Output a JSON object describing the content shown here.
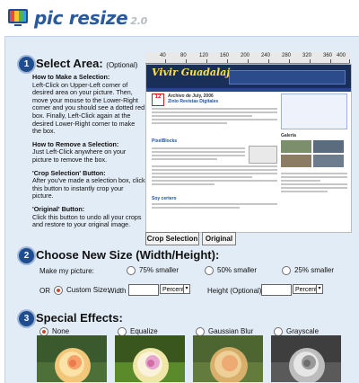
{
  "app": {
    "name": "pic resize",
    "version": "2.0"
  },
  "step1": {
    "number": "1",
    "title": "Select Area:",
    "title_note": "(Optional)",
    "instructions": {
      "selection_heading": "How to Make a Selection:",
      "selection_text": "Left-Click on Upper-Left corner of desired area on your picture. Then, move your mouse to the Lower-Right corner and you should see a dotted red box. Finally, Left-Click again at the desired Lower-Right corner to make the box.",
      "remove_heading": "How to Remove a Selection:",
      "remove_text": "Just Left-Click anywhere on your picture to remove the box.",
      "crop_heading": "'Crop Selection' Button:",
      "crop_text": "After you've made a selection box, click this button to instantly crop your picture.",
      "original_heading": "'Original' Button:",
      "original_text": "Click this button to undo all your crops and restore to your original image."
    },
    "ruler_ticks": [
      "40",
      "80",
      "120",
      "160",
      "200",
      "240",
      "280",
      "320",
      "360",
      "400"
    ],
    "crop_button": "Crop Selection",
    "original_button": "Original"
  },
  "preview": {
    "site_logo": "Vivir Guadalajara",
    "post1_date": "Archivo de July, 2006",
    "post1_title": "Zinio Revistas Digitales",
    "post2_title": "PixelBlocks",
    "post3_title": "Soy certero",
    "side_title": "Galería"
  },
  "step2": {
    "number": "2",
    "title": "Choose New Size (Width/Height):",
    "make_picture_label": "Make my picture:",
    "options": [
      "75% smaller",
      "50% smaller",
      "25% smaller"
    ],
    "or_label": "OR",
    "custom_label": "Custom Size:",
    "width_label": "Width",
    "width_value": "",
    "width_unit": "Percent",
    "height_label": "Height (Optional)",
    "height_value": "",
    "height_unit": "Percent"
  },
  "step3": {
    "number": "3",
    "title": "Special Effects:",
    "effects": [
      "None",
      "Equalize",
      "Gaussian Blur",
      "Grayscale"
    ],
    "selected": "None"
  },
  "colors": {
    "accent": "#1f4d8f",
    "panel": "#e2ecf6",
    "brand": "#2a5a9c",
    "radio_selected": "#c54a2f"
  }
}
